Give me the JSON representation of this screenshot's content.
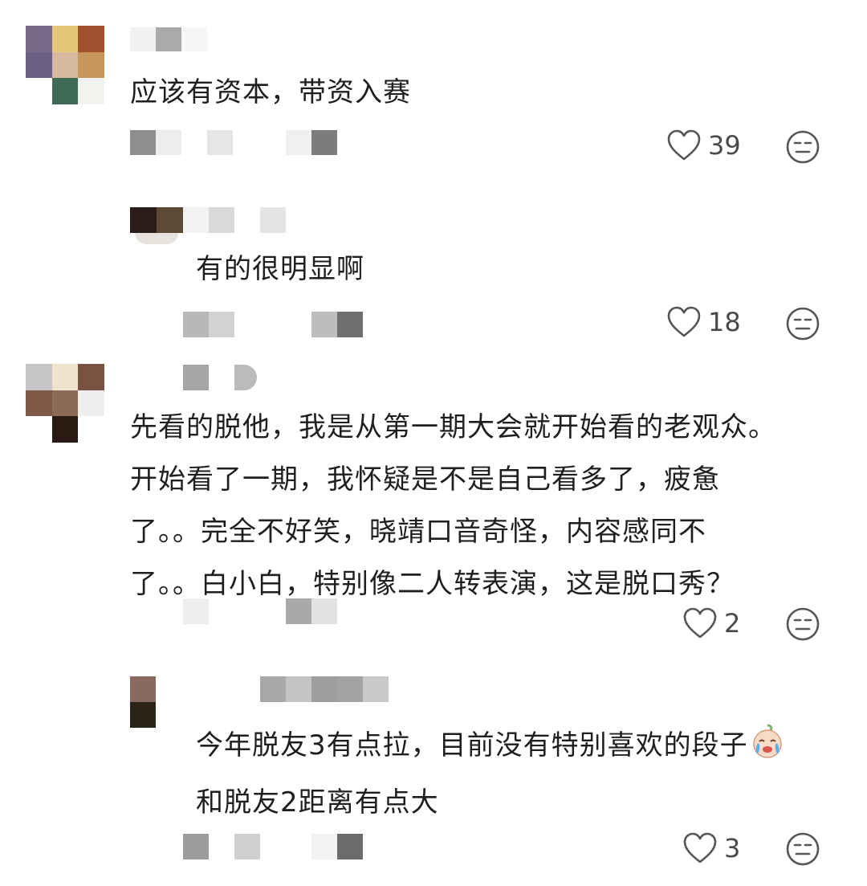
{
  "colors": {
    "text": "#1f1f1f",
    "meta": "#4a4a4a",
    "icon": "#555555"
  },
  "comments": [
    {
      "id": "c1",
      "lines": [
        "应该有资本，带资入赛"
      ],
      "likes": "39",
      "icons": {
        "like": "heart-outline-icon",
        "react": "expressionless-face-icon"
      }
    },
    {
      "id": "c2",
      "lines": [
        "有的很明显啊"
      ],
      "likes": "18",
      "icons": {
        "like": "heart-outline-icon",
        "react": "expressionless-face-icon"
      }
    },
    {
      "id": "c3",
      "lines": [
        "先看的脱他，我是从第一期大会就开始看的老观众。",
        "开始看了一期，我怀疑是不是自己看多了，疲惫",
        "了。。完全不好笑，晓靖口音奇怪，内容感同不",
        "了。。白小白，特别像二人转表演，这是脱口秀？"
      ],
      "likes": "2",
      "icons": {
        "like": "heart-outline-icon",
        "react": "expressionless-face-icon"
      }
    },
    {
      "id": "c4",
      "lines": [
        "今年脱友3有点拉，目前没有特别喜欢的段子",
        "和脱友2距离有点大"
      ],
      "sticker": "crying-baby-sticker-icon",
      "likes": "3",
      "icons": {
        "like": "heart-outline-icon",
        "react": "expressionless-face-icon"
      }
    }
  ]
}
